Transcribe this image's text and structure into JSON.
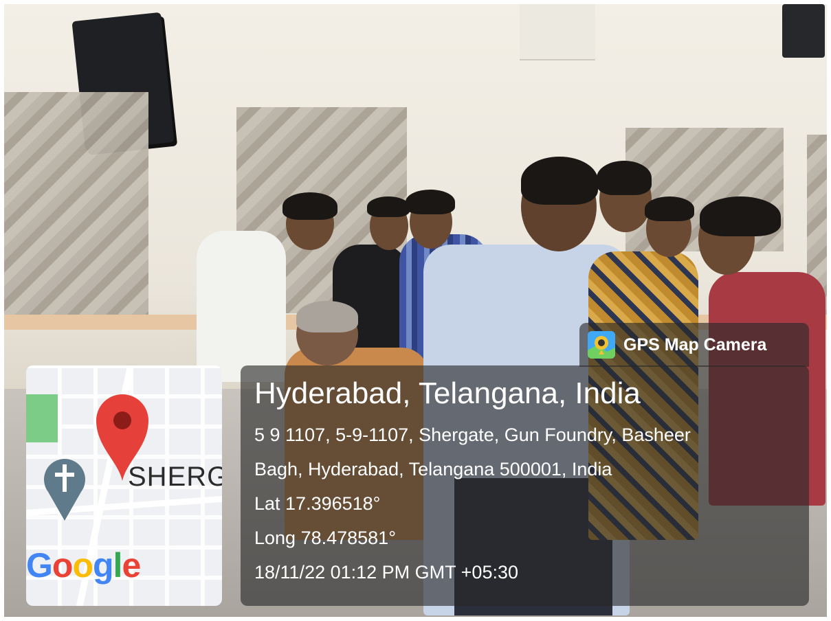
{
  "brand": {
    "icon": "gps-camera-logo-icon",
    "name": "GPS Map Camera"
  },
  "map": {
    "place_label": "SHERG",
    "pin_icon": "location-pin-icon",
    "poi_icon": "church-icon",
    "logo_text": {
      "g1": "G",
      "o1": "o",
      "o2": "o",
      "g2": "g",
      "l": "l",
      "e": "e"
    },
    "logo_colors": [
      "#4285f4",
      "#ea4335",
      "#fbbc05",
      "#34a853"
    ]
  },
  "location": {
    "title": "Hyderabad, Telangana, India",
    "address_line1": "5 9 1107, 5-9-1107, Shergate, Gun Foundry, Basheer",
    "address_line2": "Bagh, Hyderabad, Telangana 500001, India",
    "latitude": "Lat 17.396518°",
    "longitude": "Long 78.478581°",
    "timestamp": "18/11/22 01:12 PM GMT +05:30"
  }
}
